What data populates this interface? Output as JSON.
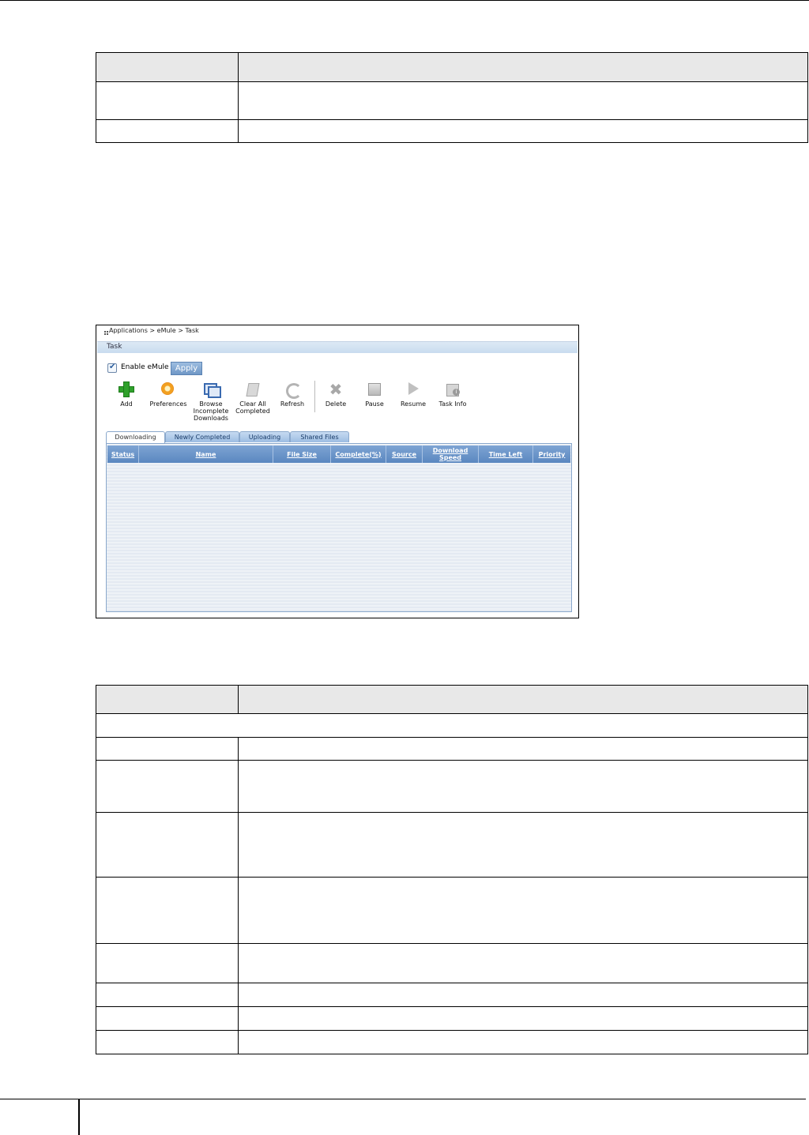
{
  "screenshot": {
    "title": "Applications > eMule > Task",
    "header": "Task",
    "enable_label": "Enable eMule",
    "apply_label": "Apply",
    "toolbar": [
      {
        "name": "add",
        "label": "Add",
        "icon": "add-icon"
      },
      {
        "name": "preferences",
        "label": "Preferences",
        "icon": "gear-icon"
      },
      {
        "name": "browse-incomplete",
        "label": "Browse Incomplete Downloads",
        "icon": "windows-icon"
      },
      {
        "name": "clear-all-completed",
        "label": "Clear All Completed",
        "icon": "clear-icon"
      },
      {
        "name": "refresh",
        "label": "Refresh",
        "icon": "refresh-icon"
      },
      {
        "name": "delete",
        "label": "Delete",
        "icon": "delete-icon"
      },
      {
        "name": "pause",
        "label": "Pause",
        "icon": "pause-icon"
      },
      {
        "name": "resume",
        "label": "Resume",
        "icon": "play-icon"
      },
      {
        "name": "task-info",
        "label": "Task Info",
        "icon": "info-icon"
      }
    ],
    "tabs": [
      "Downloading",
      "Newly Completed",
      "Uploading",
      "Shared Files"
    ],
    "columns": [
      "Status",
      "Name",
      "File Size",
      "Complete(%)",
      "Source",
      "Download Speed",
      "Time Left",
      "Priority"
    ]
  },
  "colors": {
    "header_band": "#c9dcef",
    "grid_header": "#5a87c0",
    "table_header": "#e8e8e8"
  }
}
